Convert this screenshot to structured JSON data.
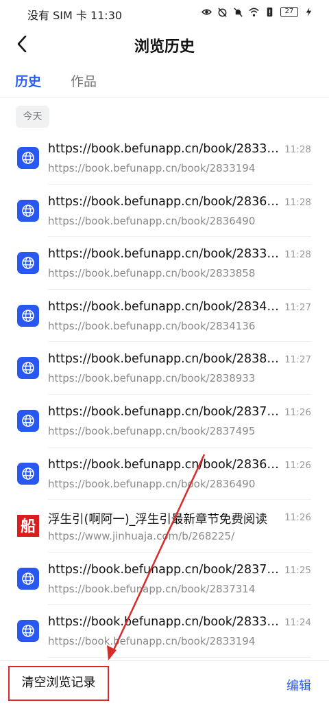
{
  "status_bar": {
    "carrier_time": "没有 SIM 卡 11:30",
    "battery": "27",
    "icons": [
      "eye-icon",
      "alarm-off-icon",
      "bell-off-icon",
      "wifi-icon",
      "battery-alert-icon",
      "battery-icon",
      "charging-icon"
    ]
  },
  "header": {
    "title": "浏览历史",
    "back_icon": "back-arrow-icon"
  },
  "tabs": [
    {
      "label": "历史",
      "active": true
    },
    {
      "label": "作品",
      "active": false
    }
  ],
  "date_group": "今天",
  "items": [
    {
      "title": "https://book.befunapp.cn/book/2833194",
      "url": "https://book.befunapp.cn/book/2833194",
      "time": "11:28",
      "icon": "globe-icon"
    },
    {
      "title": "https://book.befunapp.cn/book/2836490",
      "url": "https://book.befunapp.cn/book/2836490",
      "time": "11:28",
      "icon": "globe-icon"
    },
    {
      "title": "https://book.befunapp.cn/book/2833858",
      "url": "https://book.befunapp.cn/book/2833858",
      "time": "11:28",
      "icon": "globe-icon"
    },
    {
      "title": "https://book.befunapp.cn/book/2834136",
      "url": "https://book.befunapp.cn/book/2834136",
      "time": "11:27",
      "icon": "globe-icon"
    },
    {
      "title": "https://book.befunapp.cn/book/2838933",
      "url": "https://book.befunapp.cn/book/2838933",
      "time": "11:27",
      "icon": "globe-icon"
    },
    {
      "title": "https://book.befunapp.cn/book/2837495",
      "url": "https://book.befunapp.cn/book/2837495",
      "time": "11:26",
      "icon": "globe-icon"
    },
    {
      "title": "https://book.befunapp.cn/book/2836490",
      "url": "https://book.befunapp.cn/book/2836490",
      "time": "11:26",
      "icon": "globe-icon"
    },
    {
      "title": "浮生引(啊阿一)_浮生引最新章节免费阅读",
      "url": "https://www.jinhuaja.com/b/268225/",
      "time": "11:26",
      "icon": "site-logo-icon"
    },
    {
      "title": "https://book.befunapp.cn/book/2837314",
      "url": "https://book.befunapp.cn/book/2837314",
      "time": "11:25",
      "icon": "globe-icon"
    },
    {
      "title": "https://book.befunapp.cn/book/2833194",
      "url": "https://book.befunapp.cn/book/2833194",
      "time": "11:24",
      "icon": "globe-icon"
    }
  ],
  "bottom": {
    "clear_label": "清空浏览记录",
    "edit_label": "编辑"
  },
  "colors": {
    "accent": "#2a5cf6",
    "annotation": "#d62b2b"
  }
}
